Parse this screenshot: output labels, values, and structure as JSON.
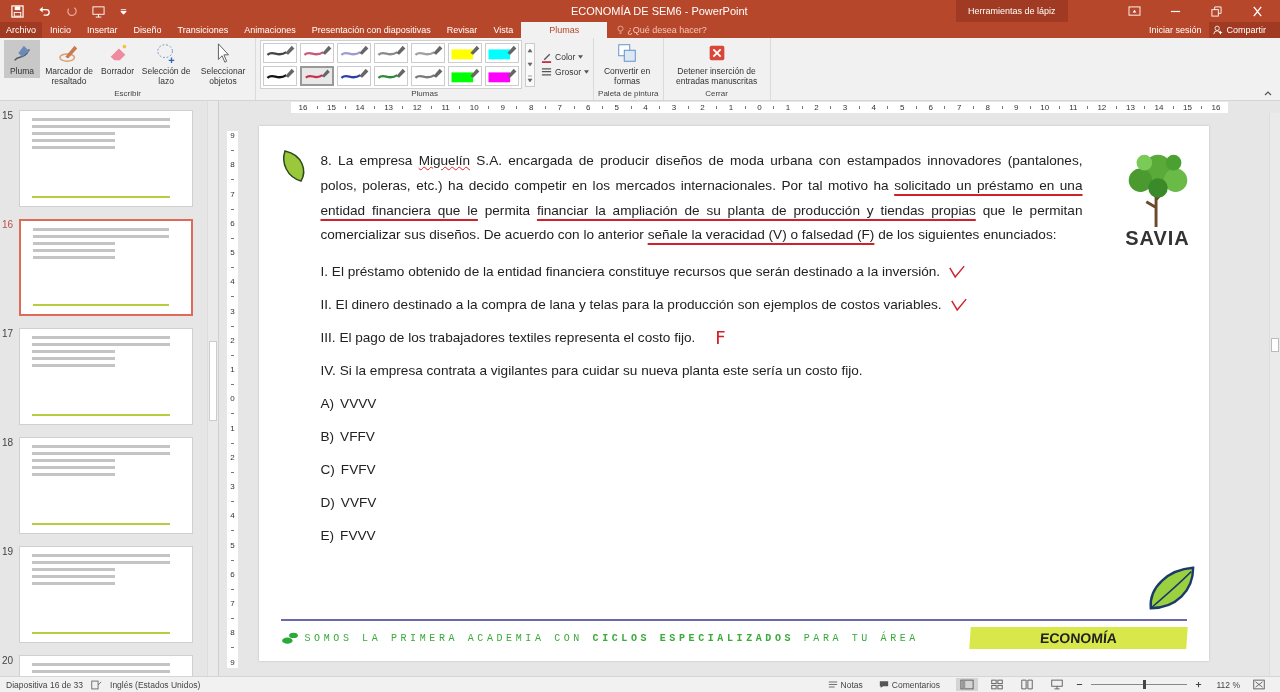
{
  "title_bar": {
    "title": "ECONOMÍA DE SEM6 - PowerPoint",
    "context_tab": "Herramientas de lápiz"
  },
  "tabs": [
    {
      "label": "Archivo",
      "selected": false
    },
    {
      "label": "Inicio",
      "selected": false
    },
    {
      "label": "Insertar",
      "selected": false
    },
    {
      "label": "Diseño",
      "selected": false
    },
    {
      "label": "Transiciones",
      "selected": false
    },
    {
      "label": "Animaciones",
      "selected": false
    },
    {
      "label": "Presentación con diapositivas",
      "selected": false
    },
    {
      "label": "Revisar",
      "selected": false
    },
    {
      "label": "Vista",
      "selected": false
    },
    {
      "label": "Plumas",
      "selected": true
    }
  ],
  "tell_me": {
    "placeholder": "¿Qué desea hacer?"
  },
  "account": {
    "sign_in": "Iniciar sesión",
    "share": "Compartir"
  },
  "ribbon": {
    "write_group": {
      "label": "Escribir",
      "tools": [
        {
          "kind": "pen",
          "label": "Pluma",
          "selected": true
        },
        {
          "kind": "highlighter",
          "label": "Marcador de resaltado",
          "selected": false
        },
        {
          "kind": "eraser",
          "label": "Borrador",
          "selected": false
        },
        {
          "kind": "lasso",
          "label": "Selección de lazo",
          "selected": false
        },
        {
          "kind": "pointer",
          "label": "Seleccionar objetos",
          "selected": false
        }
      ]
    },
    "pens_group": {
      "label": "Plumas",
      "pens": [
        {
          "kind": "pen",
          "color": "#444444",
          "selected": false
        },
        {
          "kind": "pen",
          "color": "#c85a78",
          "selected": false
        },
        {
          "kind": "pen",
          "color": "#9b9bd0",
          "selected": false
        },
        {
          "kind": "pen",
          "color": "#8a8a8a",
          "selected": false
        },
        {
          "kind": "pen",
          "color": "#a0a0a0",
          "selected": false
        },
        {
          "kind": "highlighter",
          "color": "#ffff00",
          "selected": false
        },
        {
          "kind": "highlighter",
          "color": "#00ffff",
          "selected": false
        },
        {
          "kind": "pen",
          "color": "#111111",
          "selected": false
        },
        {
          "kind": "pen",
          "color": "#c8304a",
          "selected": true
        },
        {
          "kind": "pen",
          "color": "#2a3fa8",
          "selected": false
        },
        {
          "kind": "pen",
          "color": "#2a8a3a",
          "selected": false
        },
        {
          "kind": "pen",
          "color": "#7a7a7a",
          "selected": false
        },
        {
          "kind": "highlighter",
          "color": "#00ff00",
          "selected": false
        },
        {
          "kind": "highlighter",
          "color": "#ff00ff",
          "selected": false
        }
      ],
      "options": [
        "Color",
        "Grosor"
      ]
    },
    "palette_group": {
      "label": "Paleta de pintura",
      "button": "Convertir en formas"
    },
    "close_group": {
      "label": "Cerrar",
      "button": "Detener inserción de entradas manuscritas"
    }
  },
  "ruler": {
    "horizontal": [
      "16",
      "15",
      "14",
      "13",
      "12",
      "11",
      "10",
      "9",
      "8",
      "7",
      "6",
      "5",
      "4",
      "3",
      "2",
      "1",
      "0",
      "1",
      "2",
      "3",
      "4",
      "5",
      "6",
      "7",
      "8",
      "9",
      "10",
      "11",
      "12",
      "13",
      "14",
      "15",
      "16"
    ],
    "vertical": [
      "9",
      "8",
      "7",
      "6",
      "5",
      "4",
      "3",
      "2",
      "1",
      "0",
      "1",
      "2",
      "3",
      "4",
      "5",
      "6",
      "7",
      "8",
      "9"
    ]
  },
  "slides_pane": [
    {
      "number": "15",
      "selected": false
    },
    {
      "number": "16",
      "selected": true
    },
    {
      "number": "17",
      "selected": false
    },
    {
      "number": "18",
      "selected": false
    },
    {
      "number": "19",
      "selected": false
    },
    {
      "number": "20",
      "selected": false
    }
  ],
  "slide": {
    "logo_text": "SAVIA",
    "question": [
      {
        "text": "8. La empresa ",
        "kind": "plain"
      },
      {
        "text": "Miguelín",
        "kind": "spellcheck"
      },
      {
        "text": " S.A. encargada de producir diseños de moda urbana con estampados innovadores (pantalones, polos, poleras, etc.) ha decido competir en los mercados internacionales. Por tal motivo ha ",
        "kind": "plain"
      },
      {
        "text": "solicitado un préstamo en una entidad financiera que le",
        "kind": "ink_underline"
      },
      {
        "text": " permita ",
        "kind": "plain"
      },
      {
        "text": "financiar la ampliación de su planta de producción y tiendas propias",
        "kind": "ink_underline"
      },
      {
        "text": " que le permitan comercializar sus diseños. De acuerdo con lo anterior ",
        "kind": "plain"
      },
      {
        "text": "señale la veracidad (V) o falsedad (F)",
        "kind": "ink_underline"
      },
      {
        "text": " de los siguientes enunciados:",
        "kind": "plain"
      }
    ],
    "statements": [
      {
        "text": "I. El préstamo obtenido de la entidad financiera constituye recursos que serán destinado a la inversión.",
        "kind": "check"
      },
      {
        "text": "II. El dinero destinado a la compra de lana y telas para la producción son ejemplos de costos variables.",
        "kind": "check"
      },
      {
        "text": "III. El pago de los trabajadores textiles representa el costo fijo.",
        "kind": "letter",
        "ink_text": "F"
      },
      {
        "text": "IV. Si la empresa contrata a vigilantes para cuidar su nueva planta este sería un costo fijo.",
        "kind": "plain"
      }
    ],
    "options": [
      {
        "letter": "A)",
        "text": "VVVV"
      },
      {
        "letter": "B)",
        "text": "VFFV"
      },
      {
        "letter": "C)",
        "text": "FVFV"
      },
      {
        "letter": "D)",
        "text": "VVFV"
      },
      {
        "letter": "E)",
        "text": "FVVV"
      }
    ],
    "footer_slogan": "SOMOS LA PRIMERA ACADEMIA CON **CICLOS ESPECIALIZADOS** PARA TU ÁREA",
    "footer_subject": "ECONOMÍA"
  },
  "status_bar": {
    "slide": "Diapositiva 16 de 33",
    "language": "Inglés (Estados Unidos)",
    "notes": "Notas",
    "comments": "Comentarios",
    "zoom": {
      "level": 0.55,
      "reading": "112 %"
    }
  }
}
